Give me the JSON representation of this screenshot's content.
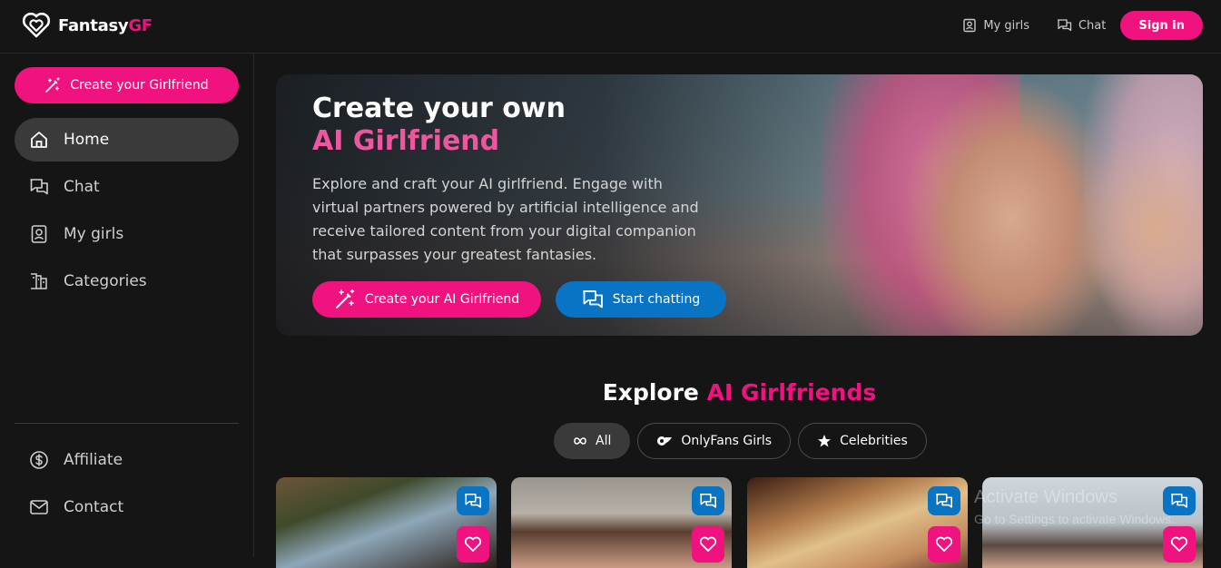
{
  "brand": {
    "name_main": "Fantasy",
    "name_accent": "GF",
    "accent_color": "#f0127f"
  },
  "top_nav": {
    "my_girls": "My girls",
    "chat": "Chat",
    "sign_in": "Sign in"
  },
  "sidebar": {
    "create_button": "Create your Girlfriend",
    "items": [
      {
        "label": "Home",
        "icon": "home-icon",
        "active": true
      },
      {
        "label": "Chat",
        "icon": "chat-icon",
        "active": false
      },
      {
        "label": "My girls",
        "icon": "my-girls-icon",
        "active": false
      },
      {
        "label": "Categories",
        "icon": "categories-icon",
        "active": false
      }
    ],
    "bottom_items": [
      {
        "label": "Affiliate",
        "icon": "dollar-icon"
      },
      {
        "label": "Contact",
        "icon": "mail-icon"
      }
    ]
  },
  "hero": {
    "title_line1": "Create your own",
    "title_line2": "AI Girlfriend",
    "description": "Explore and craft your AI girlfriend. Engage with virtual partners powered by artificial intelligence and receive tailored content from your digital companion that surpasses your greatest fantasies.",
    "create_button": "Create your AI Girlfriend",
    "chat_button": "Start chatting"
  },
  "explore": {
    "title_main": "Explore",
    "title_accent": "AI Girlfriends",
    "filters": [
      {
        "label": "All",
        "icon": "infinity-icon",
        "active": true
      },
      {
        "label": "OnlyFans Girls",
        "icon": "onlyfans-icon",
        "active": false
      },
      {
        "label": "Celebrities",
        "icon": "star-icon",
        "active": false
      }
    ]
  },
  "watermark": {
    "line1": "Activate Windows",
    "line2": "Go to Settings to activate Windows."
  }
}
